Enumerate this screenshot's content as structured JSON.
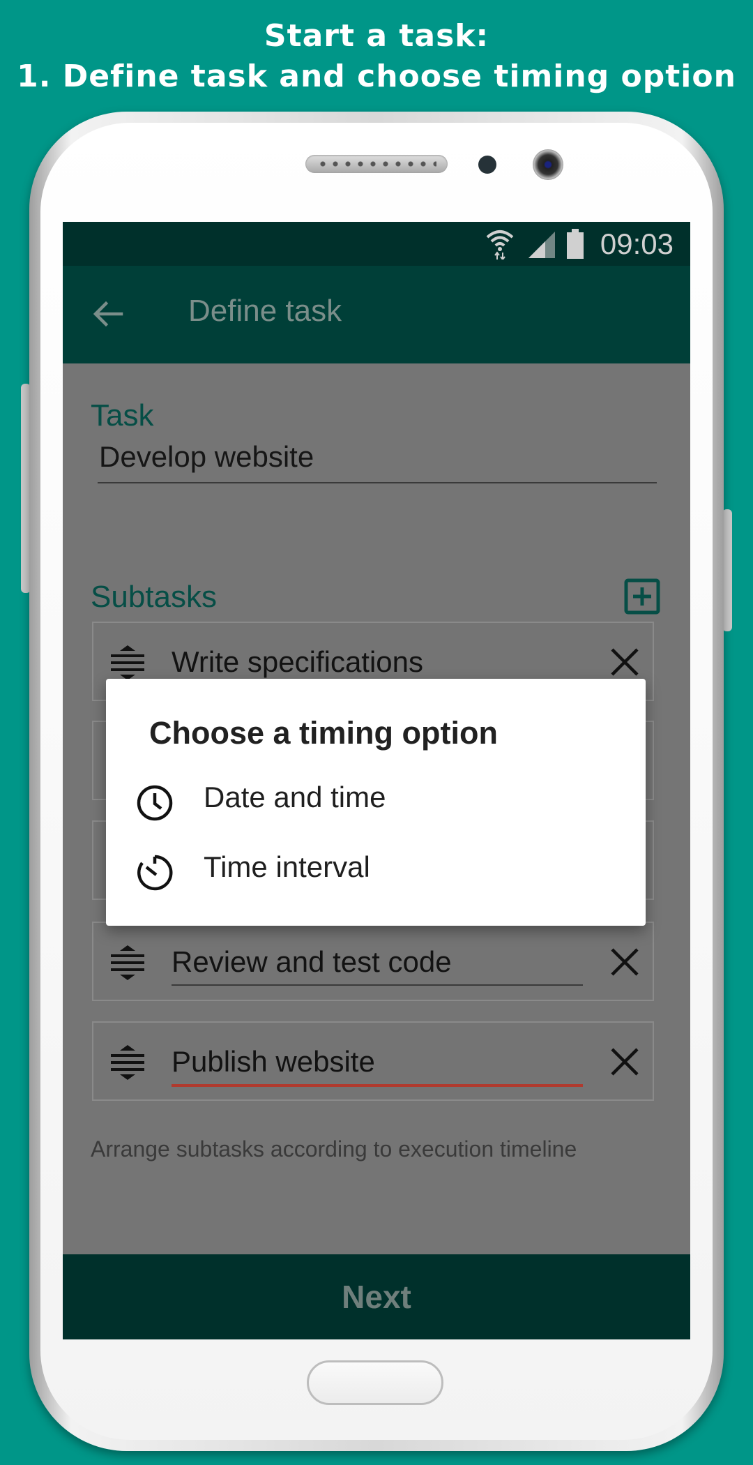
{
  "caption": {
    "line1": "Start a task:",
    "line2": "1. Define task and choose timing option"
  },
  "status_bar": {
    "time": "09:03",
    "icons": [
      "wifi-icon",
      "signal-icon",
      "battery-icon"
    ]
  },
  "app_bar": {
    "back_icon": "arrow-left-icon",
    "title": "Define task"
  },
  "task": {
    "label": "Task",
    "value": "Develop website"
  },
  "subtasks": {
    "label": "Subtasks",
    "add_icon": "add-box-icon",
    "items": [
      {
        "text": "Write specifications"
      },
      {
        "text": ""
      },
      {
        "text": ""
      },
      {
        "text": "Review and test code"
      },
      {
        "text": "Publish website"
      }
    ],
    "hint": "Arrange subtasks according to execution timeline"
  },
  "next_button": {
    "label": "Next"
  },
  "dialog": {
    "title": "Choose a timing option",
    "options": [
      {
        "label": "Date and time",
        "icon": "clock-icon"
      },
      {
        "label": "Time interval",
        "icon": "timer-icon"
      }
    ]
  },
  "colors": {
    "background": "#009688",
    "app_bar": "#003f38",
    "status_bar": "#00302b",
    "accent": "#064e46",
    "active_underline": "#b03a2e"
  }
}
